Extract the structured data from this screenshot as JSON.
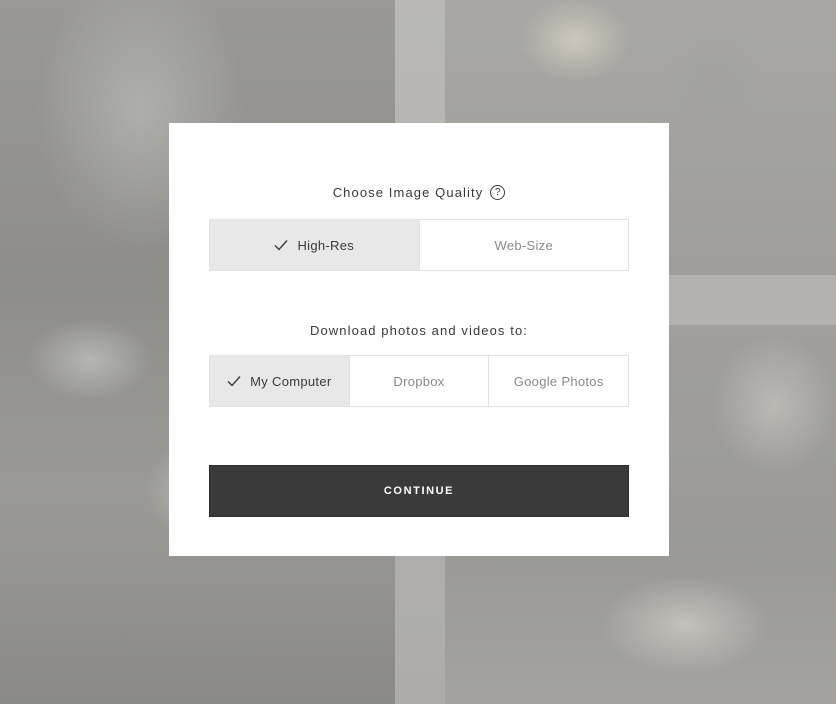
{
  "dialog": {
    "quality_title": "Choose Image Quality",
    "help_icon": "question-circle-icon",
    "quality_options": [
      {
        "label": "High-Res",
        "selected": true
      },
      {
        "label": "Web-Size",
        "selected": false
      }
    ],
    "destination_title": "Download photos and videos to:",
    "destination_options": [
      {
        "label": "My Computer",
        "selected": true
      },
      {
        "label": "Dropbox",
        "selected": false
      },
      {
        "label": "Google Photos",
        "selected": false
      }
    ],
    "continue_label": "CONTINUE",
    "selected_icon": "checkmark-icon"
  },
  "colors": {
    "primary_button": "#3a3a3a",
    "selected_option_bg": "#e8e8e8",
    "unselected_text": "#8a8a8a"
  }
}
